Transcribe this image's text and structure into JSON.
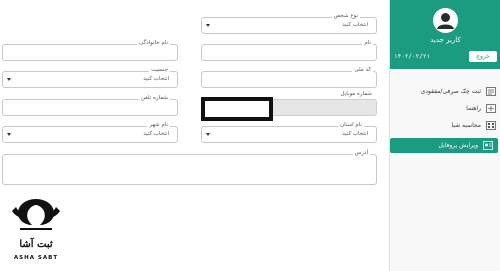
{
  "sidebar": {
    "user_name": "کاربر جدید",
    "date": "۱۴۰۲/۰۲/۲۱",
    "logout_label": "خروج",
    "menu": [
      {
        "label": "ثبت چک صرفی/مفقودی",
        "icon": "checklist-icon"
      },
      {
        "label": "راهنما",
        "icon": "help-icon"
      },
      {
        "label": "محاسبه شبا",
        "icon": "calculator-icon"
      },
      {
        "label": "ویرایش پروفایل",
        "icon": "profile-icon"
      }
    ],
    "colors": {
      "accent": "#1b9c80"
    }
  },
  "form": {
    "person_type": {
      "label": "نوع شخص",
      "value": "انتخاب کنید"
    },
    "first_name": {
      "label": "نام",
      "value": ""
    },
    "last_name": {
      "label": "نام خانوادگی",
      "value": ""
    },
    "national_code": {
      "label": "کد ملی",
      "value": ""
    },
    "gender": {
      "label": "جنسیت",
      "value": "انتخاب کنید"
    },
    "mobile": {
      "label": "شماره موبایل",
      "value": ""
    },
    "phone": {
      "label": "شماره تلفن",
      "value": ""
    },
    "province": {
      "label": "نام استان",
      "value": "انتخاب کنید"
    },
    "city": {
      "label": "نام شهر",
      "value": "انتخاب کنید"
    },
    "address": {
      "label": "آدرس",
      "value": ""
    }
  },
  "logo": {
    "text_fa": "ثبت آشا",
    "text_en": "ASHA SABT"
  }
}
